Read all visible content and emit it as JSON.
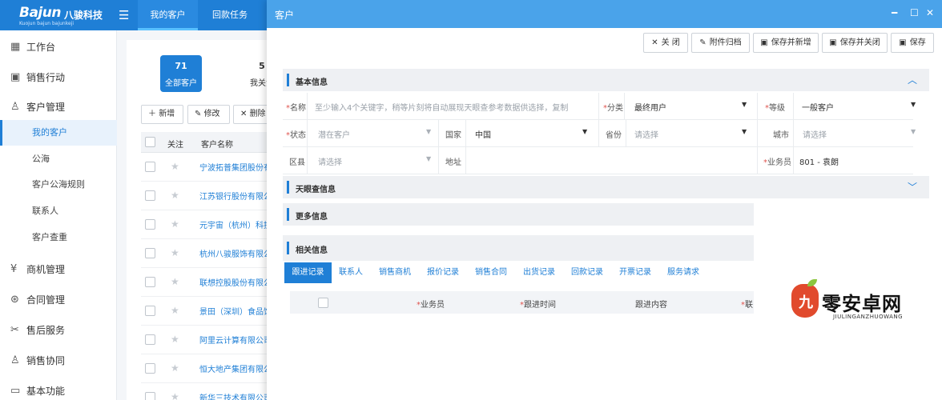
{
  "brand": {
    "name": "Bajun",
    "name_cn": "八骏科技",
    "tagline": "Kuojun bajun bajunkeji"
  },
  "topnav": {
    "tabs": [
      {
        "label": "我的客户",
        "active": true
      },
      {
        "label": "回款任务",
        "active": false
      }
    ]
  },
  "sidebar": {
    "items": [
      {
        "label": "工作台",
        "icon": "grid-icon"
      },
      {
        "label": "销售行动",
        "icon": "calendar-check-icon"
      },
      {
        "label": "客户管理",
        "icon": "user-icon"
      },
      {
        "label": "商机管理",
        "icon": "money-icon"
      },
      {
        "label": "合同管理",
        "icon": "contract-icon"
      },
      {
        "label": "售后服务",
        "icon": "tools-icon"
      },
      {
        "label": "销售协同",
        "icon": "team-icon"
      },
      {
        "label": "基本功能",
        "icon": "monitor-icon"
      }
    ],
    "sub_items": [
      {
        "label": "我的客户",
        "active": true
      },
      {
        "label": "公海",
        "active": false
      },
      {
        "label": "客户公海规则",
        "active": false
      },
      {
        "label": "联系人",
        "active": false
      },
      {
        "label": "客户查重",
        "active": false
      }
    ]
  },
  "list": {
    "stats": [
      {
        "num": "71",
        "label": "全部客户"
      },
      {
        "num": "5",
        "label": "我关注"
      }
    ],
    "toolbar": {
      "add": "新增",
      "edit": "修改",
      "delete": "删除"
    },
    "headers": {
      "follow": "关注",
      "name": "客户名称"
    },
    "rows": [
      "宁波拓普集团股份有限公司",
      "江苏银行股份有限公司",
      "元宇宙（杭州）科技有限公司",
      "杭州八骏服饰有限公司",
      "联想控股股份有限公司",
      "景田（深圳）食品饮料集团有限公司",
      "阿里云计算有限公司",
      "恒大地产集团有限公司",
      "新华三技术有限公司"
    ]
  },
  "modal": {
    "title": "客户",
    "actions": [
      {
        "label": "关 闭",
        "icon": "close-icon"
      },
      {
        "label": "附件归档",
        "icon": "paperclip-icon"
      },
      {
        "label": "保存并新增",
        "icon": "save-icon"
      },
      {
        "label": "保存并关闭",
        "icon": "save-icon"
      },
      {
        "label": "保存",
        "icon": "save-icon"
      }
    ],
    "sections": {
      "basic": "基本信息",
      "tianyancha": "天眼查信息",
      "more": "更多信息",
      "related": "相关信息"
    },
    "form": {
      "name_label": "名称",
      "name_placeholder": "至少输入4个关键字，稍等片刻将自动展现天眼查参考数据供选择，复制",
      "category_label": "分类",
      "category_value": "最终用户",
      "level_label": "等级",
      "level_value": "一般客户",
      "status_label": "状态",
      "status_value": "潜在客户",
      "country_label": "国家",
      "country_value": "中国",
      "province_label": "省份",
      "province_placeholder": "请选择",
      "city_label": "城市",
      "city_placeholder": "请选择",
      "district_label": "区县",
      "district_placeholder": "请选择",
      "address_label": "地址",
      "salesperson_label": "业务员",
      "salesperson_value": "801 - 袁朗"
    },
    "related_tabs": [
      "跟进记录",
      "联系人",
      "销售商机",
      "报价记录",
      "销售合同",
      "出货记录",
      "回款记录",
      "开票记录",
      "服务请求"
    ],
    "related_columns": {
      "salesperson": "业务员",
      "follow_time": "跟进时间",
      "follow_content": "跟进内容",
      "contact": "联"
    }
  },
  "watermark": {
    "char": "九",
    "text": "零安卓网",
    "sub": "JIULINGANZHUOWANG"
  }
}
